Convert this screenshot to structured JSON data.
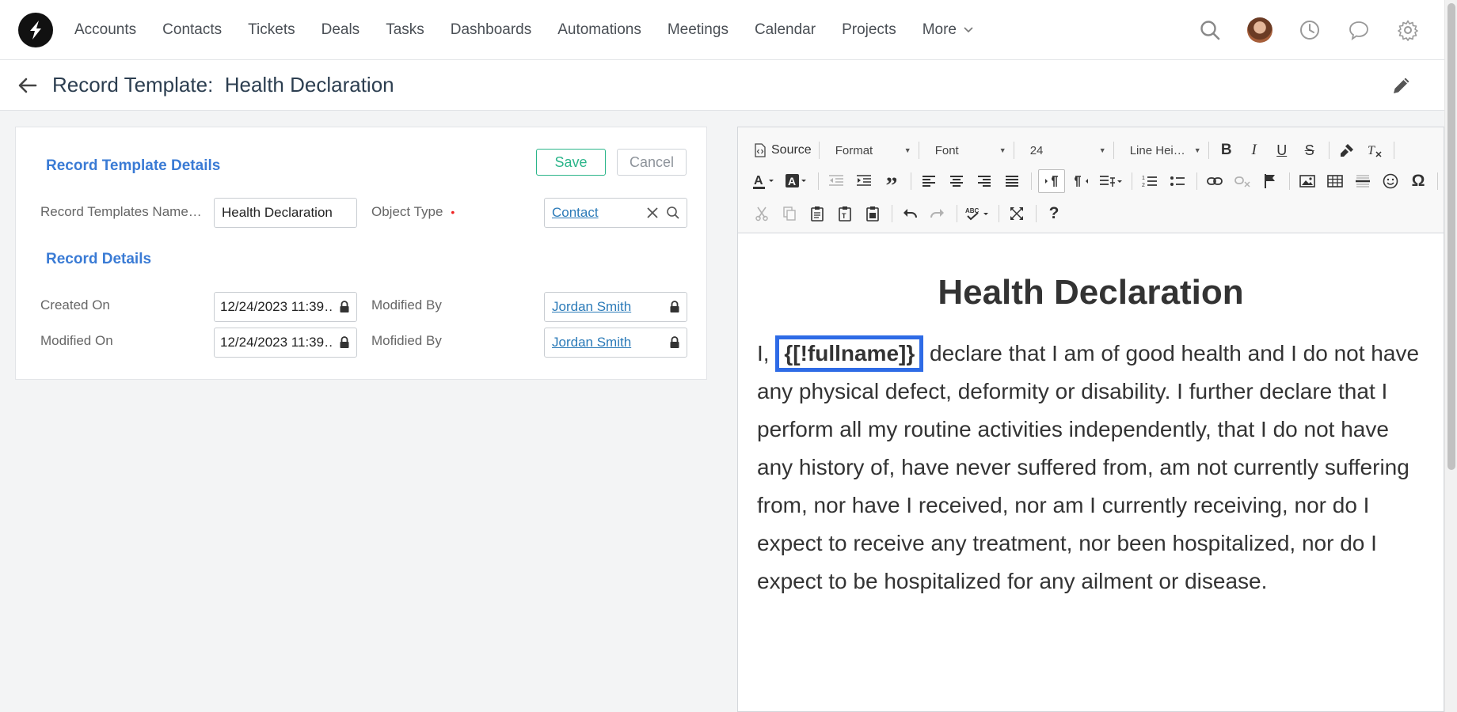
{
  "nav": {
    "items": [
      "Accounts",
      "Contacts",
      "Tickets",
      "Deals",
      "Tasks",
      "Dashboards",
      "Automations",
      "Meetings",
      "Calendar",
      "Projects"
    ],
    "more_label": "More"
  },
  "header": {
    "title": "Record Template:  Health Declaration"
  },
  "form": {
    "template_details_title": "Record Template Details",
    "save_label": "Save",
    "cancel_label": "Cancel",
    "name_label": "Record Templates Name…",
    "name_value": "Health Declaration",
    "object_type_label": "Object Type",
    "required_mark": "•",
    "object_type_value": "Contact",
    "record_details_title": "Record Details",
    "created_on_label": "Created On",
    "created_on_value": "12/24/2023 11:39…",
    "modified_by_label": "Modified By",
    "modified_by_value": "Jordan Smith",
    "modified_on_label": "Modified On",
    "modified_on_value": "12/24/2023 11:39…",
    "mofidied_by_label": "Mofidied By",
    "mofidied_by_value": "Jordan Smith"
  },
  "toolbar": {
    "source_label": "Source",
    "format_label": "Format",
    "font_label": "Font",
    "size_value": "24",
    "line_height_label": "Line Hei…"
  },
  "document": {
    "title": "Health Declaration",
    "para_prefix": "I, ",
    "placeholder": "{[!fullname]}",
    "para_body": " declare that I am of good health and I do not have any physical defect, deformity or disability. I further declare that I perform all my routine activities independently, that I do not have any history of, have never suffered from, am not currently suffering from, nor have I received, nor am I currently receiving, nor do I expect to receive any treatment, nor been hospitalized, nor do I expect to be hospitalized for any ailment or disease."
  },
  "colors": {
    "accent_blue": "#3a7bd5",
    "save_green": "#2bb58a",
    "placeholder_border": "#2e6be6",
    "link": "#2a7ab8"
  }
}
